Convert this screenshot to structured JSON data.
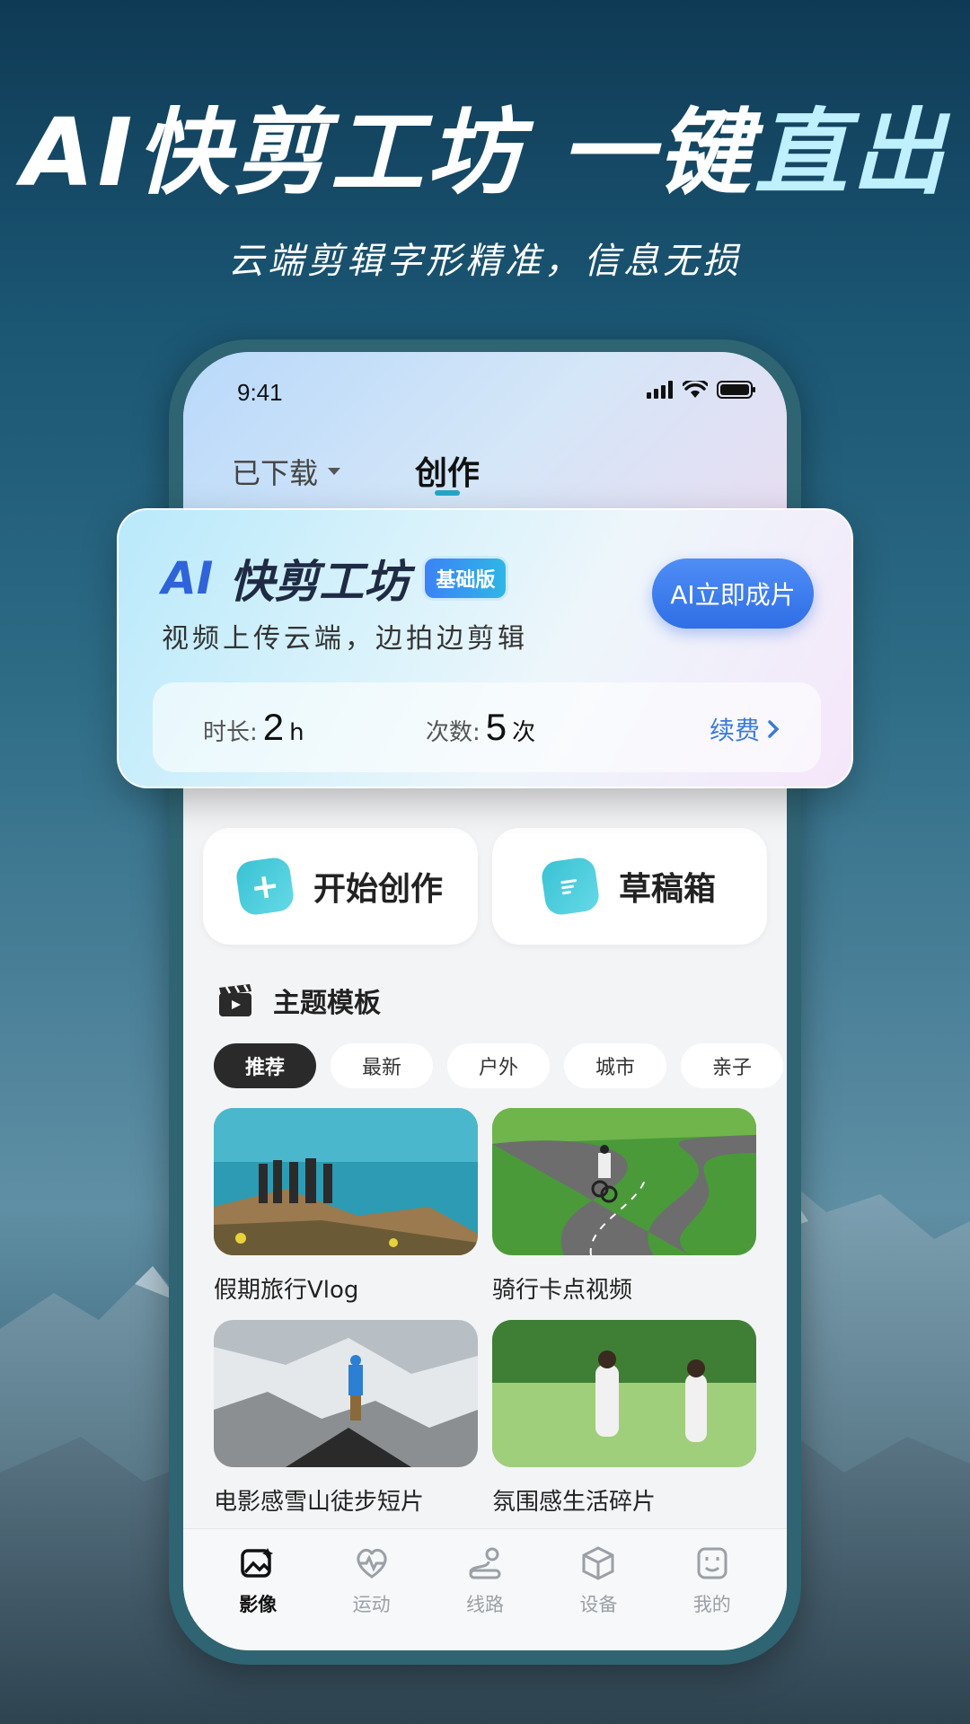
{
  "header": {
    "headline_main": "AI快剪工坊 一键",
    "headline_accent": "直出",
    "subheadline": "云端剪辑字形精准，信息无损"
  },
  "status_bar": {
    "time": "9:41"
  },
  "top_tabs": {
    "downloaded": "已下载",
    "create": "创作"
  },
  "ai_card": {
    "title_prefix": "AI",
    "title": "快剪工坊",
    "badge": "基础版",
    "description": "视频上传云端，边拍边剪辑",
    "action": "AI立即成片",
    "duration_label": "时长:",
    "duration_value": "2",
    "duration_unit": "h",
    "count_label": "次数:",
    "count_value": "5",
    "count_unit": "次",
    "renew": "续费"
  },
  "quick_actions": {
    "start": "开始创作",
    "drafts": "草稿箱"
  },
  "templates": {
    "section_title": "主题模板",
    "chips": [
      "推荐",
      "最新",
      "户外",
      "城市",
      "亲子"
    ],
    "active_chip": "推荐",
    "items": [
      {
        "title": "假期旅行Vlog"
      },
      {
        "title": "骑行卡点视频"
      },
      {
        "title": "电影感雪山徒步短片"
      },
      {
        "title": "氛围感生活碎片"
      }
    ]
  },
  "bottom_nav": {
    "items": [
      {
        "label": "影像",
        "icon": "image-icon",
        "active": true
      },
      {
        "label": "运动",
        "icon": "heart-pulse-icon",
        "active": false
      },
      {
        "label": "线路",
        "icon": "route-icon",
        "active": false
      },
      {
        "label": "设备",
        "icon": "cube-icon",
        "active": false
      },
      {
        "label": "我的",
        "icon": "profile-icon",
        "active": false
      }
    ]
  },
  "colors": {
    "accent": "#23a6c6",
    "primary_button": "#2f6ee6",
    "renew_link": "#3a7bd5"
  }
}
